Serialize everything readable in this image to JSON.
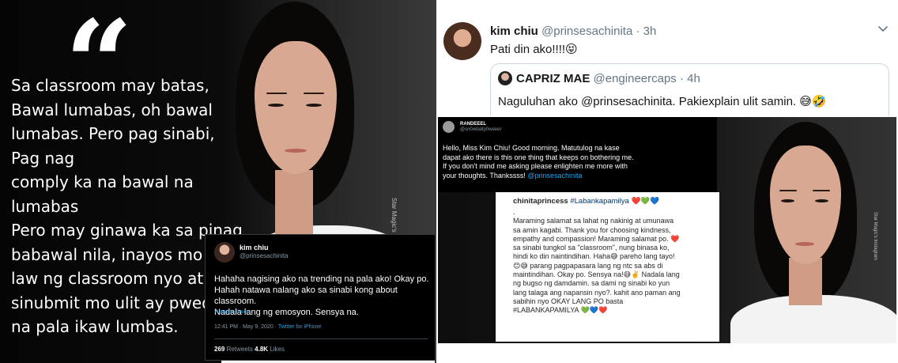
{
  "quote_image": {
    "quote_mark": "“",
    "text": "Sa classroom may batas,\nBawal lumabas, oh bawal\nlumabas. Pero pag sinabi, Pag nag\ncomply ka na bawal na lumabas\nPero may ginawa ka sa pinag\nbabawal nila, inayos mo yung\nlaw ng classroom nyo at\nsinubmit mo ulit ay pwede\nna pala ikaw lumbas.",
    "watermark": "Star Magic's Instagram"
  },
  "embedded_tweet": {
    "name": "kim chiu",
    "handle": "@prinsesachinita",
    "text": "Hahaha nagising ako na trending na pala ako! Okay po.\nHahah natawa nalang ako sa sinabi kong about classroom.\nNadala lang  ng emosyon. Sensya na.",
    "translate": "Translate Tweet",
    "timestamp": "12:41 PM · May 9, 2020 · ",
    "via": "Twitter for iPhone",
    "retweets": "269",
    "retweets_label": " Retweets   ",
    "likes": "4.8K",
    "likes_label": " Likes"
  },
  "tweet": {
    "name": "kim chiu",
    "handle": "@prinsesachinita",
    "dot": " · ",
    "time": "3h",
    "text": "Pati din ako!!!!😝",
    "chevron_icon": "chevron-down-icon"
  },
  "quoted_tweet": {
    "name": "CAPRIZ MAE",
    "handle": "@engineercaps",
    "dot": " · ",
    "time": "4h",
    "text": "Naguluhan ako @prinsesachinita. Pakiexplain ulit samin. 😅🤣"
  },
  "quoted_media": {
    "dm": {
      "name": "RANDEEEL",
      "handle": "@sn0wballp0weeer",
      "text": "Hello, Miss Kim Chiu! Good morning. Matutulog na kase\ndapat ako there is this one thing that keeps on bothering me.\nIf you don't mind me asking please enlighten me more with\nyour thoughts. Thankssss! ",
      "mention": "@prinsesachinita"
    },
    "instagram": {
      "user": "chinitaprincess",
      "hashtag": "#Labankapamilya",
      "hearts": "❤️💚💙",
      "text": ".\nMaraming salamat sa lahat ng nakinig at umunawa\nsa amin kagabi. Thank you for choosing kindness,\nempathy and compassion! Maraming salamat po. ❤️\nsa sinabi tungkol sa \"classroom\", nung binasa ko,\nhindi ko din naintindihan. Haha😅 pareho lang tayo!\n😊😅 parang pagpapasara lang ng ntc sa abs di\nmaintindihan. Okay po. Sensya na!😅✌️ Nadala lang\nng bugso ng damdamin. sa dami ng sinabi ko yun\nlang talaga ang napansin nyo?. kahit ano paman ang\nsabihin nyo OKAY LANG PO basta\n#LABANKAPAMILYA ",
      "end_hearts": "💚💙❤️"
    },
    "watermark": "Star Magic's Instagram"
  }
}
